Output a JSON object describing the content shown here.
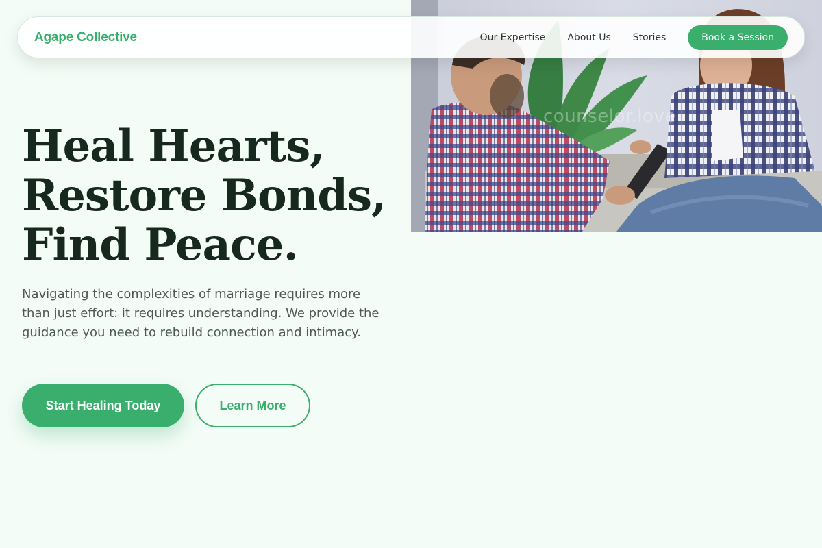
{
  "nav": {
    "brand": "Agape Collective",
    "links": [
      "Our Expertise",
      "About Us",
      "Stories"
    ],
    "cta": "Book a Session"
  },
  "hero": {
    "title_lines": [
      "Heal Hearts,",
      "Restore Bonds,",
      "Find Peace."
    ],
    "description": "Navigating the complexities of marriage requires more than just effort: it requires understanding. We provide the guidance you need to rebuild connection and intimacy.",
    "primary_button": "Start Healing Today",
    "secondary_button": "Learn More",
    "image_watermark": "counselor.love"
  },
  "colors": {
    "accent": "#3aae6c",
    "background": "#f4fcf7",
    "heading": "#17291f",
    "body_text": "#4b5a55"
  }
}
